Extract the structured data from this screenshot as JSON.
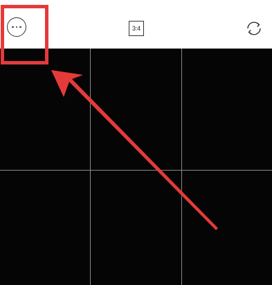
{
  "camera": {
    "topbar": {
      "more_icon": "more-horizontal-icon",
      "aspect_ratio_label": "3:4",
      "switch_icon": "camera-switch-icon"
    },
    "annotation": {
      "highlight_color": "#e53a3a",
      "arrow_color": "#e53a3a"
    },
    "viewfinder": {
      "background": "#050505",
      "grid": "3x3"
    }
  }
}
